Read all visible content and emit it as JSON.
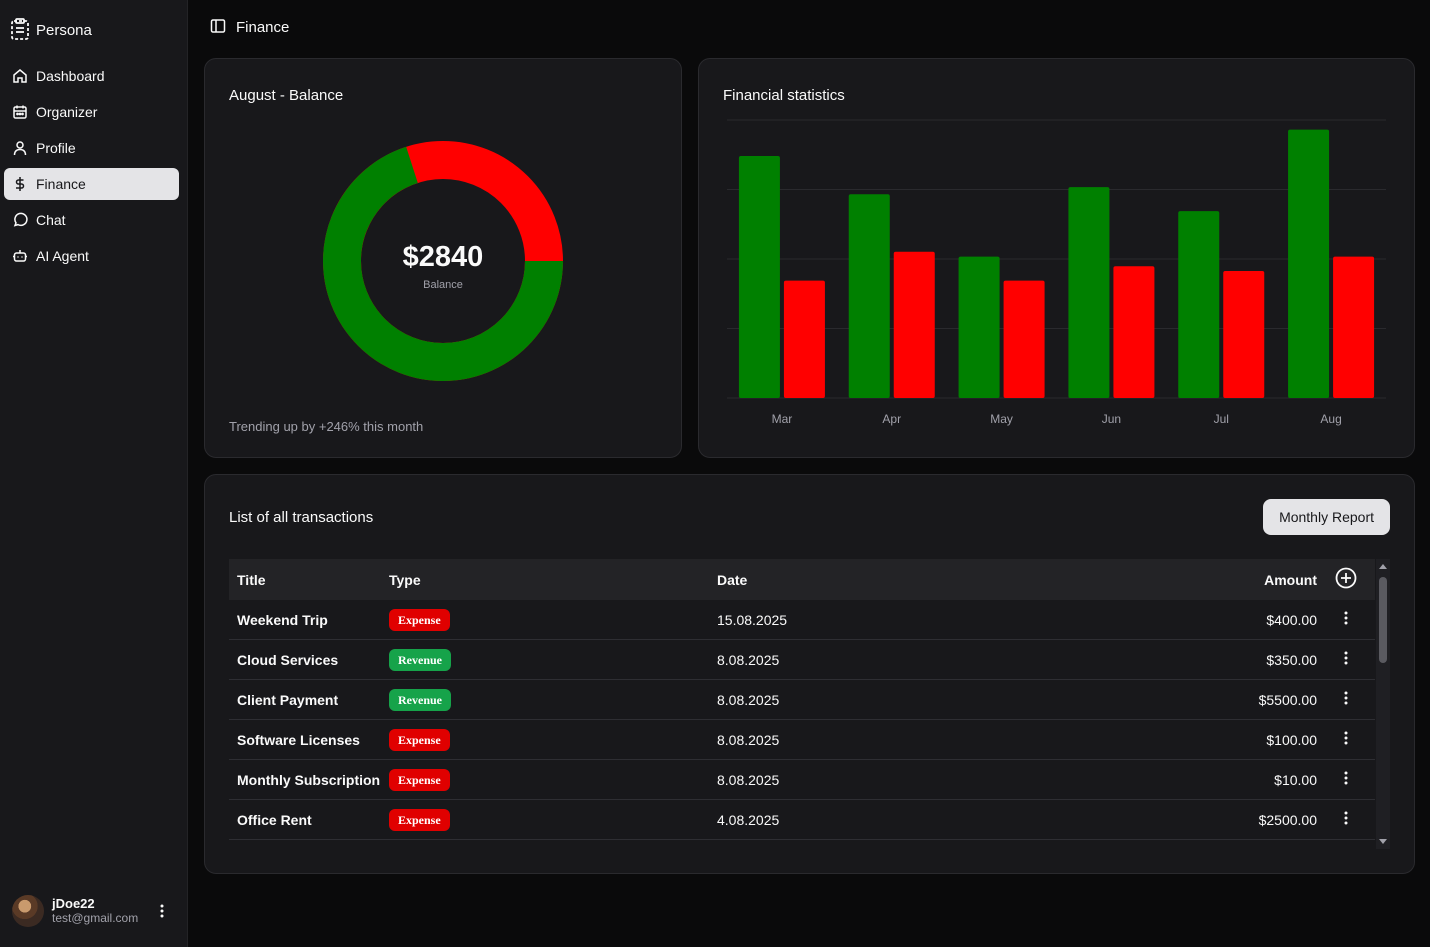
{
  "app": {
    "name": "Persona"
  },
  "header": {
    "title": "Finance"
  },
  "sidebar": {
    "items": [
      {
        "label": "Dashboard",
        "icon": "home-icon"
      },
      {
        "label": "Organizer",
        "icon": "calendar-icon"
      },
      {
        "label": "Profile",
        "icon": "user-icon"
      },
      {
        "label": "Finance",
        "icon": "dollar-icon",
        "active": true
      },
      {
        "label": "Chat",
        "icon": "chat-icon"
      },
      {
        "label": "AI Agent",
        "icon": "bot-icon"
      }
    ],
    "user": {
      "name": "jDoe22",
      "email": "test@gmail.com"
    }
  },
  "balance_card": {
    "title": "August - Balance",
    "value": "$2840",
    "label": "Balance",
    "trend": "Trending up by +246% this month",
    "revenue_share": 0.7,
    "colors": {
      "revenue": "#008000",
      "expense": "#ff0000"
    }
  },
  "stats_card": {
    "title": "Financial statistics"
  },
  "chart_data": {
    "type": "bar",
    "title": "Financial statistics",
    "categories": [
      "Mar",
      "Apr",
      "May",
      "Jun",
      "Jul",
      "Aug"
    ],
    "series": [
      {
        "color": "#008000",
        "values": [
          5050,
          4250,
          2950,
          4400,
          3900,
          5600
        ]
      },
      {
        "color": "#ff0000",
        "values": [
          2450,
          3050,
          2450,
          2750,
          2650,
          2950
        ]
      }
    ],
    "ylim": [
      0,
      5800
    ],
    "grid": true
  },
  "transactions": {
    "title": "List of all transactions",
    "report_button": "Monthly Report",
    "columns": {
      "title": "Title",
      "type": "Type",
      "date": "Date",
      "amount": "Amount"
    },
    "rows": [
      {
        "title": "Weekend Trip",
        "type": "Expense",
        "date": "15.08.2025",
        "amount": "$400.00"
      },
      {
        "title": "Cloud Services",
        "type": "Revenue",
        "date": "8.08.2025",
        "amount": "$350.00"
      },
      {
        "title": "Client Payment",
        "type": "Revenue",
        "date": "8.08.2025",
        "amount": "$5500.00"
      },
      {
        "title": "Software Licenses",
        "type": "Expense",
        "date": "8.08.2025",
        "amount": "$100.00"
      },
      {
        "title": "Monthly Subscription",
        "type": "Expense",
        "date": "8.08.2025",
        "amount": "$10.00"
      },
      {
        "title": "Office Rent",
        "type": "Expense",
        "date": "4.08.2025",
        "amount": "$2500.00"
      }
    ]
  }
}
